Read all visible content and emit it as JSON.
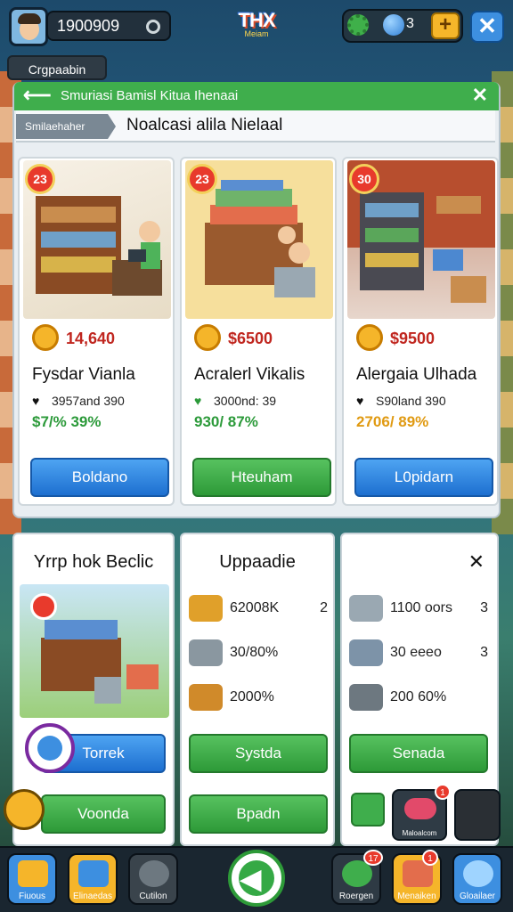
{
  "topbar": {
    "coins": "1900909",
    "logo_big": "THX",
    "logo_small": "Meiam",
    "gems": "3",
    "tag": "Crgpaabin"
  },
  "panel": {
    "title": "Smuriasi Bamisl Kitua Ihenaai",
    "subtag": "Smilaehaher",
    "subtitle": "Noalcasi alila Nielaal"
  },
  "cards": [
    {
      "badge": "23",
      "price": "14,640",
      "name": "Fysdar Vianla",
      "stat": "3957and 390",
      "pct": "$7/% 39%",
      "button": "Boldano"
    },
    {
      "badge": "23",
      "price": "$6500",
      "name": "Acralerl Vikalis",
      "stat": "3000nd: 39",
      "pct": "930/ 87%",
      "button": "Hteuham"
    },
    {
      "badge": "30",
      "price": "$9500",
      "name": "Alergaia Ulhada",
      "stat": "S90land 390",
      "pct": "2706/ 89%",
      "button": "L0pidarn"
    }
  ],
  "lower": {
    "left": {
      "title": "Yrrp hok Beclic",
      "btn1": "Torrek",
      "btn2": "Voonda"
    },
    "mid": {
      "title": "Uppaadie",
      "rows": [
        {
          "text": "62008K",
          "n": "2"
        },
        {
          "text": "30/80%",
          "n": ""
        },
        {
          "text": "2000%",
          "n": ""
        }
      ],
      "btn1": "Systda",
      "btn2": "Bpadn"
    },
    "right": {
      "close": "✕",
      "rows": [
        {
          "text": "1100 oors",
          "n": "3"
        },
        {
          "text": "30 eeeo",
          "n": "3"
        },
        {
          "text": "200 60%",
          "n": ""
        }
      ],
      "btn1": "Senada",
      "mini1": "Maloalcom",
      "mini1_badge": "1"
    }
  },
  "nav": [
    {
      "label": "Fiuous",
      "badge": ""
    },
    {
      "label": "Elinaedas",
      "badge": ""
    },
    {
      "label": "Cutilon",
      "badge": ""
    },
    {
      "label": "Roergen",
      "badge": "17"
    },
    {
      "label": "Menaiken",
      "badge": "1"
    },
    {
      "label": "Gloailaer",
      "badge": ""
    }
  ],
  "colors": {
    "accent_green": "#3fae4c",
    "accent_blue": "#1d6fd0",
    "price_red": "#c0261f"
  }
}
